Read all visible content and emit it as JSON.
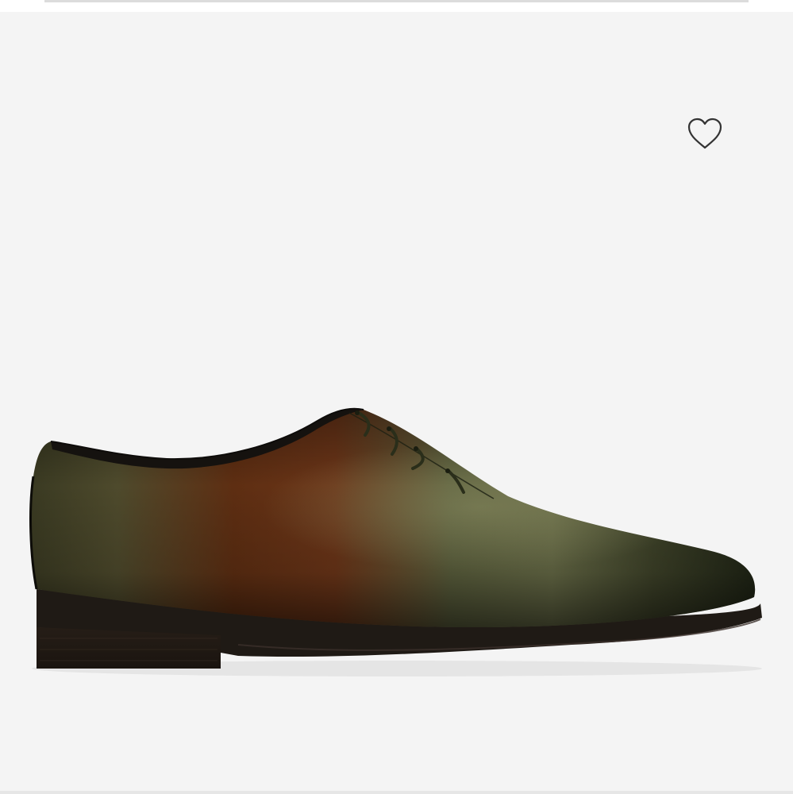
{
  "product_image": {
    "icon": "oxford-shoe-image",
    "accent_colors": {
      "background": "#f4f4f4",
      "leather_dark": "#2a2f1f",
      "leather_brown": "#6b3518",
      "leather_olive": "#5a5e3c",
      "sole": "#1f1a15",
      "heel": "#2a211b"
    }
  },
  "wishlist": {
    "icon": "heart-outline-icon",
    "stroke_color": "#333333"
  }
}
